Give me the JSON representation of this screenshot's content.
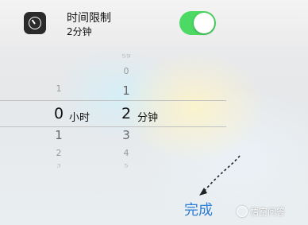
{
  "header": {
    "title": "时间限制",
    "subtitle": "2分钟",
    "toggle_on": true,
    "toggle_color": "#4cd964",
    "icon": "timer-icon"
  },
  "picker": {
    "hours": {
      "above": [
        "1"
      ],
      "selected": "0",
      "unit": "小时",
      "below": [
        "1",
        "2",
        "3"
      ]
    },
    "minutes": {
      "above": [
        "59",
        "0",
        "1"
      ],
      "selected": "2",
      "unit": "分钟",
      "below": [
        "3",
        "4",
        "5"
      ]
    }
  },
  "footer": {
    "done_label": "完成",
    "done_color": "#2f7fd8",
    "watermark": "悟空问答"
  }
}
